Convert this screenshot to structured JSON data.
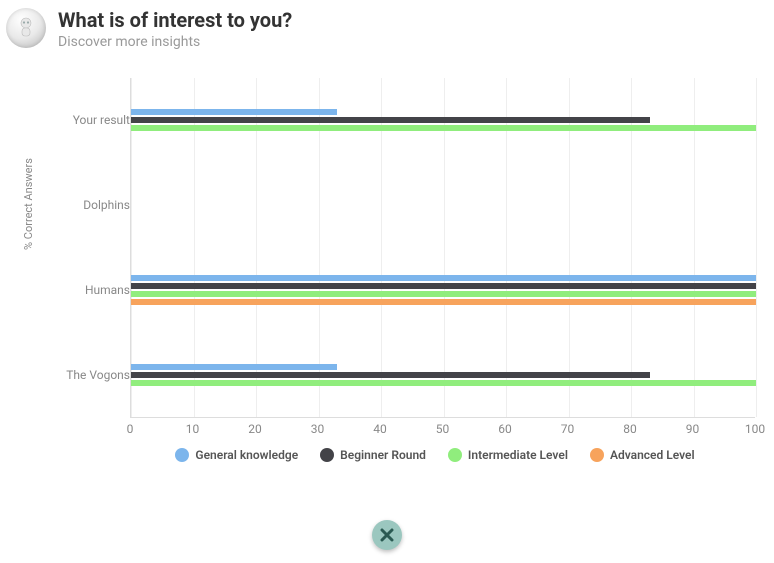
{
  "header": {
    "title": "What is of interest to you?",
    "subtitle": "Discover more insights"
  },
  "chart_data": {
    "type": "bar",
    "orientation": "horizontal",
    "ylabel": "% Correct Answers",
    "xlabel": "",
    "xlim": [
      0,
      100
    ],
    "xticks": [
      0,
      10,
      20,
      30,
      40,
      50,
      60,
      70,
      80,
      90,
      100
    ],
    "categories": [
      "Your result",
      "Dolphins",
      "Humans",
      "The Vogons"
    ],
    "series": [
      {
        "name": "General knowledge",
        "color": "#7cb5ec",
        "values": [
          33,
          0,
          100,
          33
        ]
      },
      {
        "name": "Beginner Round",
        "color": "#434348",
        "values": [
          83,
          0,
          100,
          83
        ]
      },
      {
        "name": "Intermediate Level",
        "color": "#90ed7d",
        "values": [
          100,
          0,
          100,
          100
        ]
      },
      {
        "name": "Advanced Level",
        "color": "#f7a35c",
        "values": [
          0,
          0,
          100,
          0
        ]
      }
    ]
  },
  "close": {
    "label": "close"
  }
}
